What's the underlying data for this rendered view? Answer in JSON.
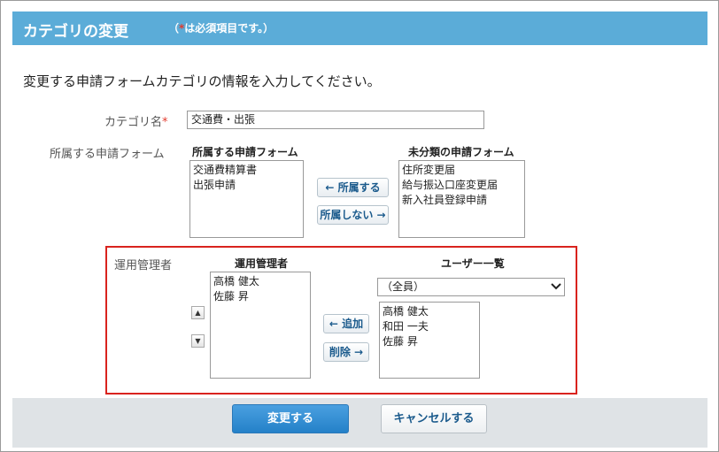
{
  "header": {
    "title": "カテゴリの変更",
    "note_prefix": "（",
    "note_asterisk": "*",
    "note_suffix": "は必須項目です。）"
  },
  "intro": "変更する申請フォームカテゴリの情報を入力してください。",
  "category_name": {
    "label": "カテゴリ名",
    "required_mark": "*",
    "value": "交通費・出張"
  },
  "forms": {
    "label": "所属する申請フォーム",
    "assigned": {
      "header": "所属する申請フォーム",
      "items": [
        "交通費精算書",
        "出張申請"
      ]
    },
    "unassigned": {
      "header": "未分類の申請フォーム",
      "items": [
        "住所変更届",
        "給与振込口座変更届",
        "新入社員登録申請"
      ]
    },
    "assign_button": "← 所属する",
    "unassign_button": "所属しない →"
  },
  "admins": {
    "label": "運用管理者",
    "current": {
      "header": "運用管理者",
      "items": [
        "高橋 健太",
        "佐藤 昇"
      ]
    },
    "users": {
      "header": "ユーザー一覧",
      "filter_value": "（全員）",
      "items": [
        "高橋 健太",
        "和田 一夫",
        "佐藤 昇"
      ]
    },
    "move_up_icon": "triangle-up-icon",
    "move_down_icon": "triangle-down-icon",
    "add_button": "← 追加",
    "remove_button": "削除 →"
  },
  "footer": {
    "submit_label": "変更する",
    "cancel_label": "キャンセルする"
  },
  "colors": {
    "header_bg": "#5bacd8",
    "required": "#e23b2e",
    "highlight_border": "#d9231e",
    "primary_button": "#2481c8",
    "footer_bg": "#dfe3e6"
  }
}
